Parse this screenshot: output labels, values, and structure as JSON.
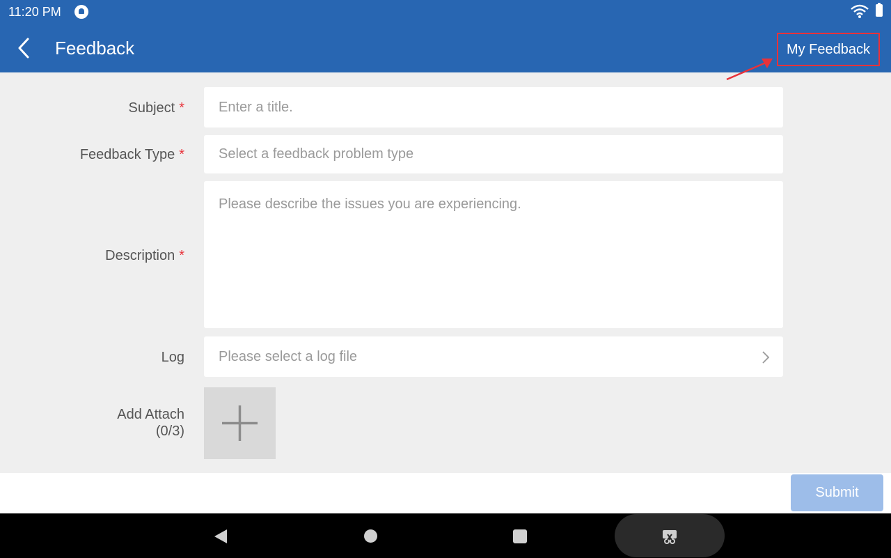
{
  "status_bar": {
    "time": "11:20 PM"
  },
  "header": {
    "title": "Feedback",
    "my_feedback_label": "My Feedback"
  },
  "form": {
    "required_mark": "*",
    "subject": {
      "label": "Subject",
      "placeholder": "Enter a title."
    },
    "feedback_type": {
      "label": "Feedback Type",
      "placeholder": "Select a feedback problem type"
    },
    "description": {
      "label": "Description",
      "placeholder": "Please describe the issues you are experiencing."
    },
    "log": {
      "label": "Log",
      "placeholder": "Please select a log file"
    },
    "attach": {
      "label": "Add Attach",
      "count": "(0/3)"
    }
  },
  "footer": {
    "submit_label": "Submit"
  },
  "colors": {
    "primary": "#2866b2",
    "required": "#e8323a",
    "annotation": "#e8323a",
    "submit_disabled": "#9dbde9",
    "background": "#efefef"
  },
  "icons": [
    "notification-icon",
    "wifi-icon",
    "battery-icon",
    "back-icon",
    "chevron-right-icon",
    "plus-icon",
    "nav-back-icon",
    "nav-home-icon",
    "nav-recent-icon",
    "screenshot-icon"
  ]
}
